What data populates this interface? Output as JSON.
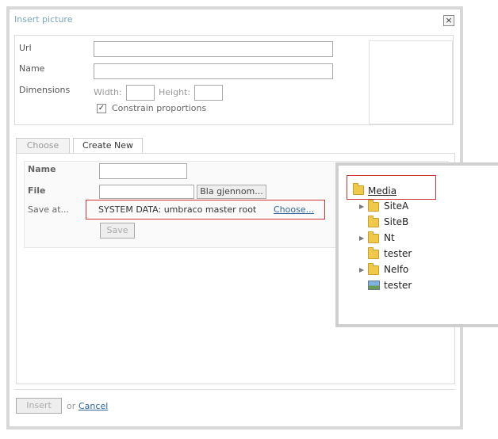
{
  "dialog": {
    "title": "Insert picture",
    "close_glyph": "×"
  },
  "form": {
    "url_label": "Url",
    "name_label": "Name",
    "dimensions_label": "Dimensions",
    "width_label": "Width:",
    "height_label": "Height:",
    "constrain_label": "Constrain proportions",
    "constrain_checked_glyph": "✓"
  },
  "tabs": [
    {
      "label": "Choose",
      "active": false
    },
    {
      "label": "Create New",
      "active": true
    }
  ],
  "create_new": {
    "name_label": "Name",
    "file_label": "File",
    "browse_label": "Bla gjennom...",
    "save_at_label": "Save at...",
    "save_at_value": "SYSTEM DATA: umbraco master root",
    "choose_link": "Choose...",
    "save_button": "Save"
  },
  "footer": {
    "insert_button": "Insert",
    "or_label": "or",
    "cancel_link": "Cancel"
  },
  "media_tree": {
    "root_label": "Media",
    "items": [
      {
        "label": "SiteA",
        "type": "folder",
        "expandable": true
      },
      {
        "label": "SiteB",
        "type": "folder",
        "expandable": false
      },
      {
        "label": "Nt",
        "type": "folder",
        "expandable": true
      },
      {
        "label": "tester",
        "type": "folder",
        "expandable": false
      },
      {
        "label": "Nelfo",
        "type": "folder",
        "expandable": true
      },
      {
        "label": "tester",
        "type": "image",
        "expandable": false
      }
    ]
  },
  "icons": {
    "folder": "folder-icon",
    "image": "image-icon",
    "expand": "expand-arrow-icon"
  },
  "colors": {
    "highlight_border": "#cc3333",
    "link": "#336699",
    "title": "#7aa6b8"
  }
}
